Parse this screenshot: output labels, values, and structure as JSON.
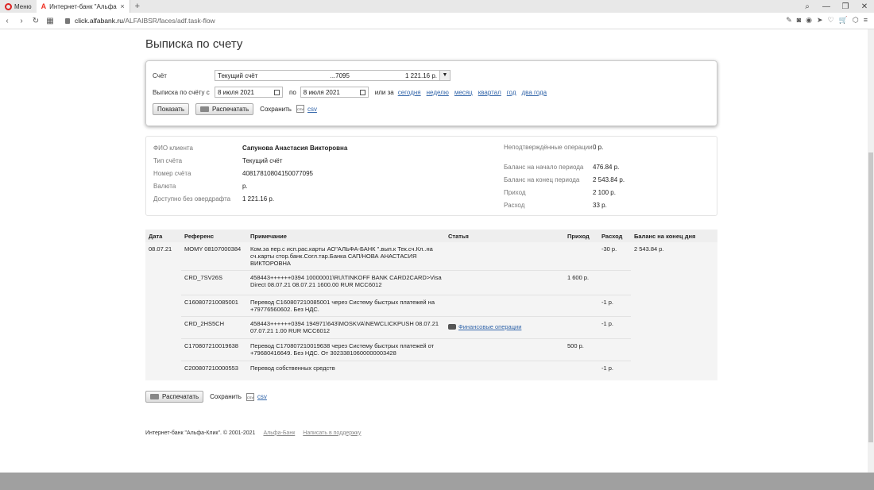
{
  "browser": {
    "menu_label": "Меню",
    "tab_title": "Интернет-банк \"Альфа-К",
    "tab_close": "×",
    "new_tab": "+",
    "url_host": "click.alfabank.ru",
    "url_path": "/ALFAIBSR/faces/adf.task-flow"
  },
  "page": {
    "title": "Выписка по счету"
  },
  "filter": {
    "account_label": "Счёт",
    "account_name": "Текущий счёт",
    "account_number": "...7095",
    "account_balance": "1 221.16 р.",
    "period_label": "Выписка по счёту с",
    "date_from": "8 июля 2021",
    "to_label": "по",
    "date_to": "8 июля 2021",
    "or_label": "или за",
    "quick_periods": [
      "сегодня",
      "неделю",
      "месяц",
      "квартал",
      "год",
      "два года"
    ],
    "show_button": "Показать",
    "print_button": "Распечатать",
    "save_label": "Сохранить",
    "csv_label": "csv",
    "csv_icon_text": "CSV"
  },
  "info": {
    "client_label": "ФИО клиента",
    "client_value": "Сапунова Анастасия Викторовна",
    "type_label": "Тип счёта",
    "type_value": "Текущий счёт",
    "number_label": "Номер счёта",
    "number_value": "40817810804150077095",
    "currency_label": "Валюта",
    "currency_value": "р.",
    "available_label": "Доступно без овердрафта",
    "available_value": "1 221.16 р.",
    "unconfirmed_label": "Неподтверждённые операции",
    "unconfirmed_value": "0 р.",
    "start_label": "Баланс на начало периода",
    "start_value": "476.84 р.",
    "end_label": "Баланс на конец периода",
    "end_value": "2 543.84 р.",
    "income_label": "Приход",
    "income_value": "2 100 р.",
    "expense_label": "Расход",
    "expense_value": "33 р."
  },
  "table": {
    "headers": [
      "Дата",
      "Референс",
      "Примечание",
      "Статья",
      "Приход",
      "Расход",
      "Баланс на конец дня"
    ],
    "date": "08.07.21",
    "end_balance": "2 543.84 р.",
    "rows": [
      {
        "ref": "MOMY 08107000384",
        "note": "Ком.за пер.с исп.рас.карты АО\"АЛЬФА-БАНК \".вып.к Тек.сч.Кл..на сч.карты стор.банк.Согл.тар.Банка САП/НОВА АНАСТАСИЯ ВИКТОРОВНА",
        "category": "",
        "income": "",
        "expense": "-30 р."
      },
      {
        "ref": "CRD_7SV26S",
        "note": "458443++++++0394 10000001\\RU\\TINKOFF BANK CARD2CARD>Visa Direct 08.07.21 08.07.21 1600.00 RUR MCC6012",
        "category": "",
        "income": "1 600 р.",
        "expense": ""
      },
      {
        "ref": "C160807210085001",
        "note": "Перевод C160807210085001 через Систему быстрых платежей на +79776560602. Без НДС.",
        "category": "",
        "income": "",
        "expense": "-1 р."
      },
      {
        "ref": "CRD_2HS5CH",
        "note": "458443++++++0394 194971\\643\\MOSKVA\\NEWCLICKPUSH 08.07.21 07.07.21 1.00 RUR MCC6012",
        "category": "Финансовые операции",
        "income": "",
        "expense": "-1 р."
      },
      {
        "ref": "C170807210019638",
        "note": "Перевод C170807210019638 через Систему быстрых платежей от +79680416649. Без НДС. От 30233810600000003428",
        "category": "",
        "income": "500 р.",
        "expense": ""
      },
      {
        "ref": "C200807210000553",
        "note": "Перевод собственных средств",
        "category": "",
        "income": "",
        "expense": "-1 р."
      }
    ]
  },
  "bottom": {
    "print_button": "Распечатать",
    "save_label": "Сохранить",
    "csv_label": "csv",
    "csv_icon_text": "CSV"
  },
  "footer": {
    "copyright": "Интернет-банк \"Альфа-Клик\". © 2001-2021",
    "link1": "Альфа-Банк",
    "link2": "Написать в поддержку"
  },
  "colors": {
    "accent": "#ef3124",
    "link": "#3366aa"
  }
}
